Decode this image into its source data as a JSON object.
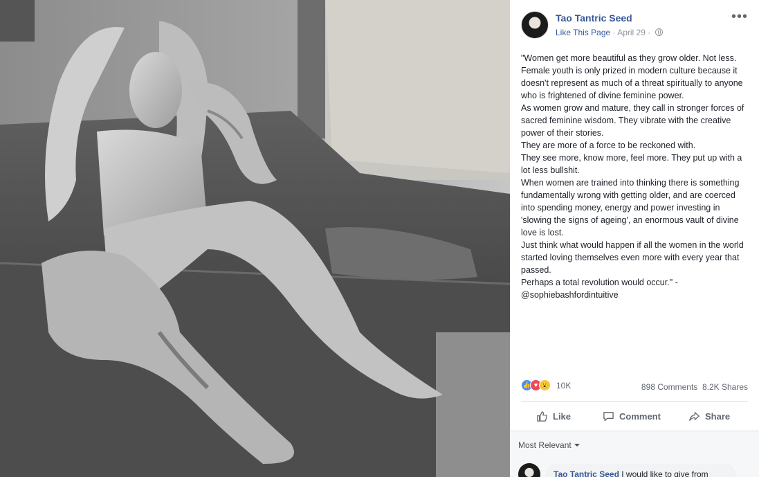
{
  "post": {
    "page_name": "Tao Tantric Seed",
    "like_link": "Like This Page",
    "separator": " · ",
    "date": "April 29",
    "privacy_icon": "globe-icon",
    "more_icon": "more-options-icon",
    "text": [
      "\"Women get more beautiful as they grow older. Not less.",
      "Female youth is only prized in modern culture because it doesn't represent as much of a threat spiritually to anyone who is frightened of divine feminine power.",
      "As women grow and mature, they call in stronger forces of sacred feminine wisdom. They vibrate with the creative power of their stories.",
      "They are more of a force to be reckoned with.",
      "They see more, know more, feel more. They put up with a lot less bullshit.",
      "When women are trained into thinking there is something fundamentally wrong with getting older, and are coerced into spending money, energy and power investing in 'slowing the signs of ageing', an enormous vault of divine love is lost.",
      "Just think what would happen if all the women in the world started loving themselves even more with every year that passed.",
      "Perhaps a total revolution would occur.\" -",
      "@sophiebashfordintuitive"
    ]
  },
  "stats": {
    "reactions_count": "10K",
    "comments": "898 Comments",
    "shares": "8.2K Shares"
  },
  "actions": {
    "like": "Like",
    "comment": "Comment",
    "share": "Share"
  },
  "comments": {
    "sort_label": "Most Relevant",
    "first_author": "Tao Tantric Seed",
    "first_text": " I would like to give from"
  },
  "colors": {
    "link": "#365899",
    "like_blue": "#4a90f2",
    "love_red": "#f0475c",
    "wow_yellow": "#f7c343"
  }
}
